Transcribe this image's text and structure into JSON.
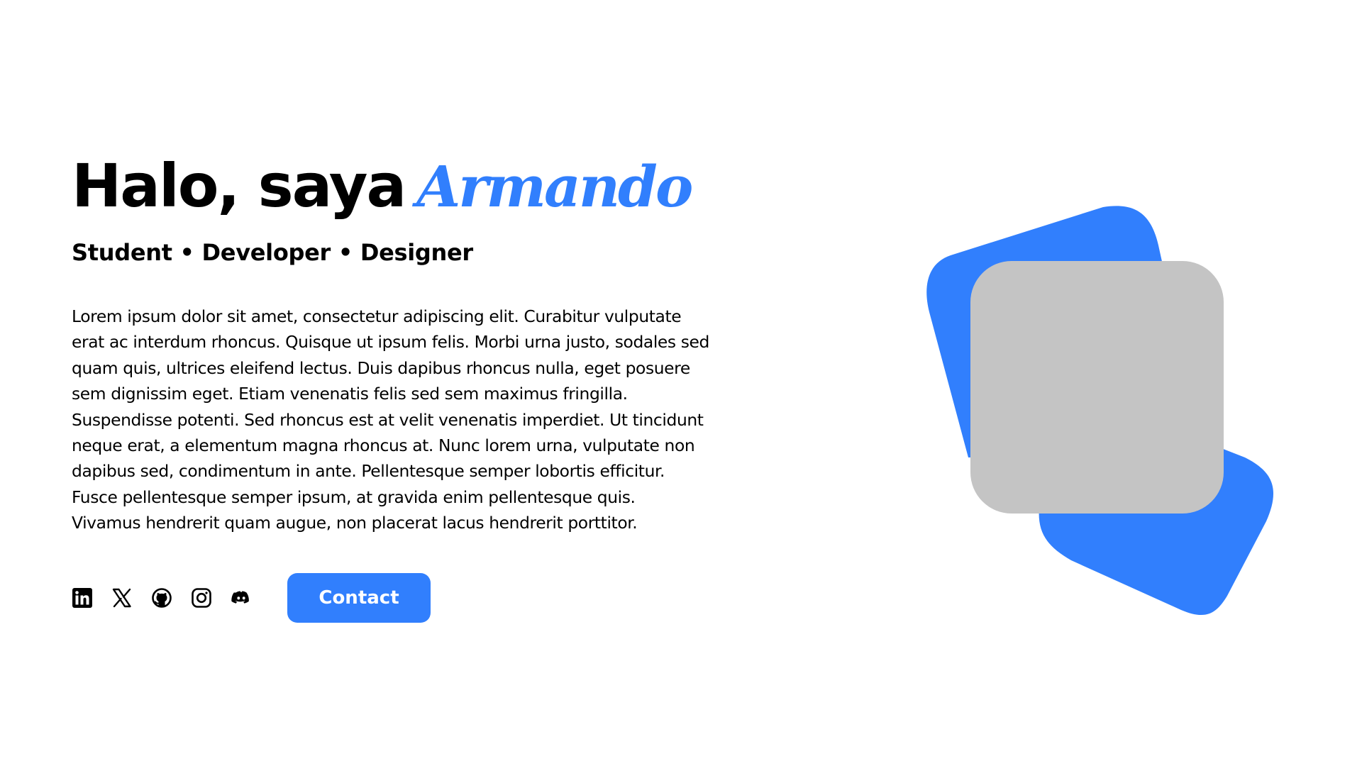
{
  "colors": {
    "accent": "#317ffd",
    "text": "#000000",
    "placeholder": "#c4c4c4",
    "background": "#ffffff"
  },
  "hero": {
    "greeting": "Halo, saya",
    "name": "Armando",
    "tagline": "Student • Developer • Designer",
    "bio_lines": [
      "Lorem ipsum dolor sit amet, consectetur adipiscing elit. Curabitur vulputate",
      "erat ac interdum rhoncus. Quisque ut ipsum felis. Morbi urna justo, sodales sed",
      "quam quis, ultrices eleifend lectus. Duis dapibus rhoncus nulla, eget posuere",
      "sem dignissim eget. Etiam venenatis felis sed sem maximus fringilla.",
      "Suspendisse potenti. Sed rhoncus est at velit venenatis imperdiet. Ut tincidunt",
      "neque erat, a elementum magna rhoncus at. Nunc lorem urna, vulputate non",
      "dapibus sed, condimentum in ante. Pellentesque semper lobortis efficitur.",
      "Fusce pellentesque semper ipsum, at gravida enim pellentesque quis.",
      "Vivamus hendrerit quam augue, non placerat lacus hendrerit porttitor."
    ]
  },
  "social": [
    {
      "icon": "linkedin-icon"
    },
    {
      "icon": "x-icon"
    },
    {
      "icon": "github-icon"
    },
    {
      "icon": "instagram-icon"
    },
    {
      "icon": "discord-icon"
    }
  ],
  "contact_button": {
    "label": "Contact"
  }
}
